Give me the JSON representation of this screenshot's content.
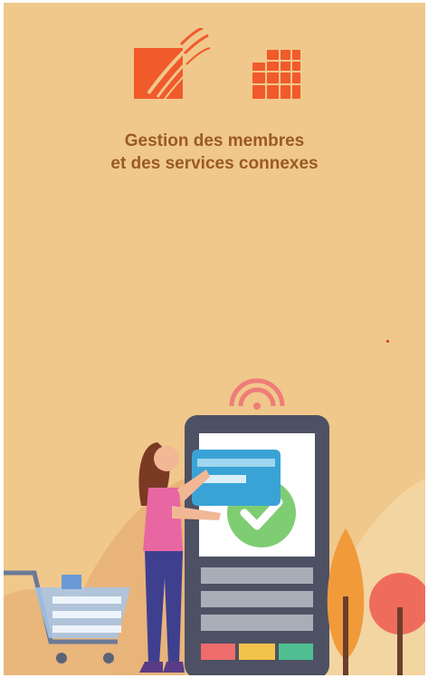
{
  "header": {
    "line1": "Gestion des membres",
    "line2": "et des services connexes"
  },
  "icons": {
    "left_logo": "swoosh-square-logo",
    "right_logo": "grid-building-logo",
    "illustration": "payment-terminal-shopping-illustration"
  },
  "colors": {
    "background": "#f0c88b",
    "brand_orange": "#f15a2b",
    "caption_text": "#9a5a24"
  }
}
